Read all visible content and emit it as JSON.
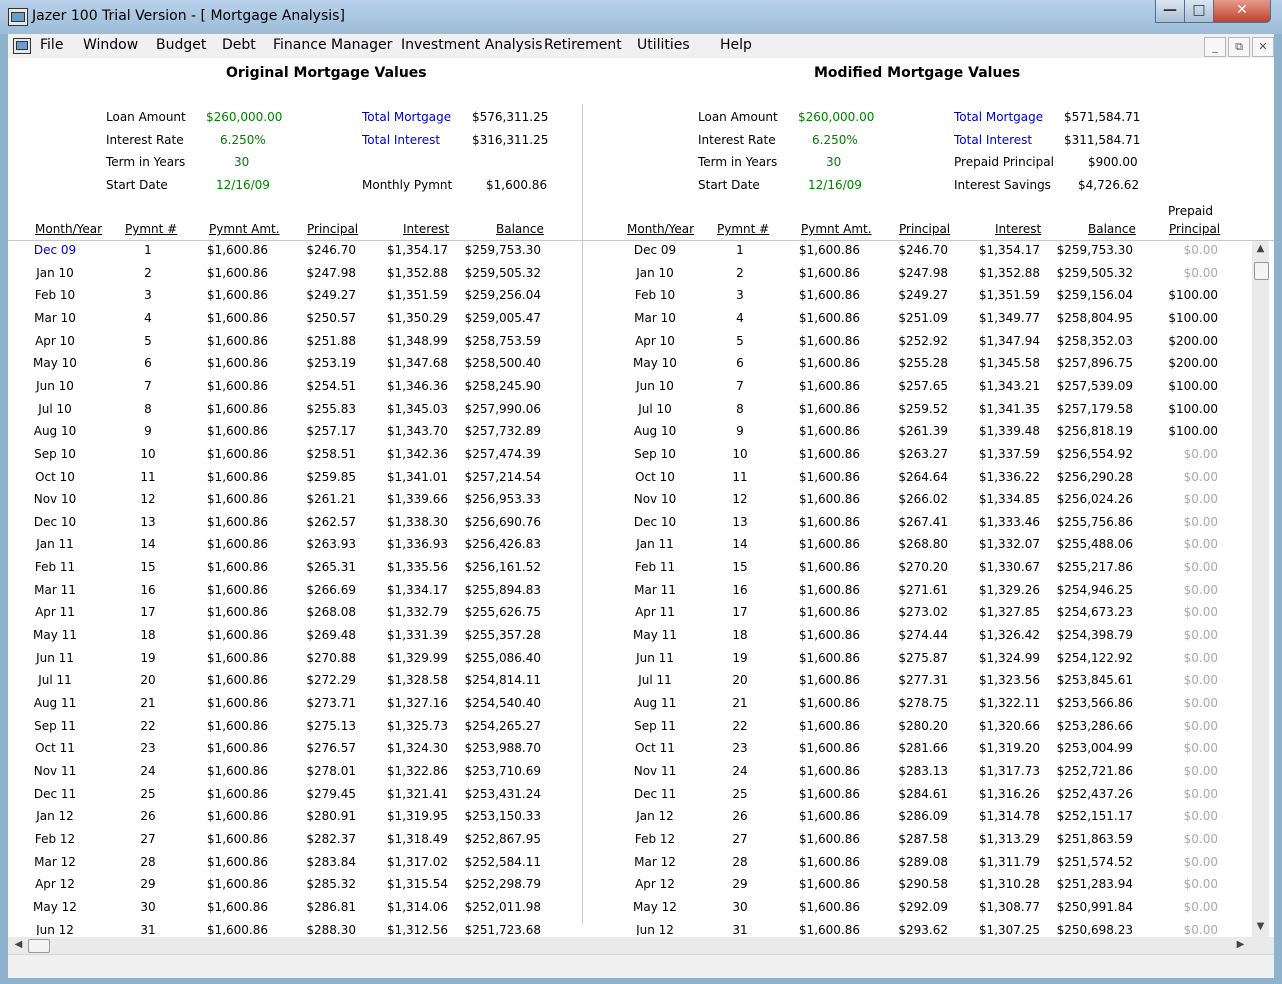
{
  "window": {
    "title": "Jazer 100 Trial Version - [ Mortgage Analysis]"
  },
  "menu": [
    "File",
    "Window",
    "Budget",
    "Debt",
    "Finance Manager",
    "Investment Analysis",
    "Retirement",
    "Utilities",
    "Help"
  ],
  "original": {
    "title": "Original Mortgage Values",
    "loan_amount_label": "Loan Amount",
    "loan_amount": "$260,000.00",
    "interest_rate_label": "Interest Rate",
    "interest_rate": "6.250%",
    "term_label": "Term in Years",
    "term": "30",
    "start_date_label": "Start Date",
    "start_date": "12/16/09",
    "total_mortgage_label": "Total Mortgage",
    "total_mortgage": "$576,311.25",
    "total_interest_label": "Total Interest",
    "total_interest": "$316,311.25",
    "monthly_pymnt_label": "Monthly Pymnt",
    "monthly_pymnt": "$1,600.86"
  },
  "modified": {
    "title": "Modified Mortgage Values",
    "loan_amount_label": "Loan Amount",
    "loan_amount": "$260,000.00",
    "interest_rate_label": "Interest Rate",
    "interest_rate": "6.250%",
    "term_label": "Term in Years",
    "term": "30",
    "start_date_label": "Start Date",
    "start_date": "12/16/09",
    "total_mortgage_label": "Total Mortgage",
    "total_mortgage": "$571,584.71",
    "total_interest_label": "Total Interest",
    "total_interest": "$311,584.71",
    "prepaid_principal_label": "Prepaid Principal",
    "prepaid_principal": "$900.00",
    "interest_savings_label": "Interest Savings",
    "interest_savings": "$4,726.62"
  },
  "columns": {
    "month_year": "Month/Year",
    "pymnt_num": "Pymnt #",
    "pymnt_amt": "Pymnt Amt.",
    "principal": "Principal",
    "interest": "Interest",
    "balance": "Balance",
    "prepaid_line1": "Prepaid",
    "prepaid_line2": "Principal"
  },
  "colors": {
    "green": "#008000",
    "blue": "#0000cc",
    "gray": "#aaaaaa"
  },
  "rows": [
    {
      "m": "Dec 09",
      "n": "1",
      "amt": "$1,600.86",
      "op": "$246.70",
      "oi": "$1,354.17",
      "ob": "$259,753.30",
      "mp": "$246.70",
      "mi": "$1,354.17",
      "mb": "$259,753.30",
      "pp": "$0.00"
    },
    {
      "m": "Jan 10",
      "n": "2",
      "amt": "$1,600.86",
      "op": "$247.98",
      "oi": "$1,352.88",
      "ob": "$259,505.32",
      "mp": "$247.98",
      "mi": "$1,352.88",
      "mb": "$259,505.32",
      "pp": "$0.00"
    },
    {
      "m": "Feb 10",
      "n": "3",
      "amt": "$1,600.86",
      "op": "$249.27",
      "oi": "$1,351.59",
      "ob": "$259,256.04",
      "mp": "$249.27",
      "mi": "$1,351.59",
      "mb": "$259,156.04",
      "pp": "$100.00"
    },
    {
      "m": "Mar 10",
      "n": "4",
      "amt": "$1,600.86",
      "op": "$250.57",
      "oi": "$1,350.29",
      "ob": "$259,005.47",
      "mp": "$251.09",
      "mi": "$1,349.77",
      "mb": "$258,804.95",
      "pp": "$100.00"
    },
    {
      "m": "Apr 10",
      "n": "5",
      "amt": "$1,600.86",
      "op": "$251.88",
      "oi": "$1,348.99",
      "ob": "$258,753.59",
      "mp": "$252.92",
      "mi": "$1,347.94",
      "mb": "$258,352.03",
      "pp": "$200.00"
    },
    {
      "m": "May 10",
      "n": "6",
      "amt": "$1,600.86",
      "op": "$253.19",
      "oi": "$1,347.68",
      "ob": "$258,500.40",
      "mp": "$255.28",
      "mi": "$1,345.58",
      "mb": "$257,896.75",
      "pp": "$200.00"
    },
    {
      "m": "Jun 10",
      "n": "7",
      "amt": "$1,600.86",
      "op": "$254.51",
      "oi": "$1,346.36",
      "ob": "$258,245.90",
      "mp": "$257.65",
      "mi": "$1,343.21",
      "mb": "$257,539.09",
      "pp": "$100.00"
    },
    {
      "m": "Jul 10",
      "n": "8",
      "amt": "$1,600.86",
      "op": "$255.83",
      "oi": "$1,345.03",
      "ob": "$257,990.06",
      "mp": "$259.52",
      "mi": "$1,341.35",
      "mb": "$257,179.58",
      "pp": "$100.00"
    },
    {
      "m": "Aug 10",
      "n": "9",
      "amt": "$1,600.86",
      "op": "$257.17",
      "oi": "$1,343.70",
      "ob": "$257,732.89",
      "mp": "$261.39",
      "mi": "$1,339.48",
      "mb": "$256,818.19",
      "pp": "$100.00"
    },
    {
      "m": "Sep 10",
      "n": "10",
      "amt": "$1,600.86",
      "op": "$258.51",
      "oi": "$1,342.36",
      "ob": "$257,474.39",
      "mp": "$263.27",
      "mi": "$1,337.59",
      "mb": "$256,554.92",
      "pp": "$0.00"
    },
    {
      "m": "Oct 10",
      "n": "11",
      "amt": "$1,600.86",
      "op": "$259.85",
      "oi": "$1,341.01",
      "ob": "$257,214.54",
      "mp": "$264.64",
      "mi": "$1,336.22",
      "mb": "$256,290.28",
      "pp": "$0.00"
    },
    {
      "m": "Nov 10",
      "n": "12",
      "amt": "$1,600.86",
      "op": "$261.21",
      "oi": "$1,339.66",
      "ob": "$256,953.33",
      "mp": "$266.02",
      "mi": "$1,334.85",
      "mb": "$256,024.26",
      "pp": "$0.00"
    },
    {
      "m": "Dec 10",
      "n": "13",
      "amt": "$1,600.86",
      "op": "$262.57",
      "oi": "$1,338.30",
      "ob": "$256,690.76",
      "mp": "$267.41",
      "mi": "$1,333.46",
      "mb": "$255,756.86",
      "pp": "$0.00"
    },
    {
      "m": "Jan 11",
      "n": "14",
      "amt": "$1,600.86",
      "op": "$263.93",
      "oi": "$1,336.93",
      "ob": "$256,426.83",
      "mp": "$268.80",
      "mi": "$1,332.07",
      "mb": "$255,488.06",
      "pp": "$0.00"
    },
    {
      "m": "Feb 11",
      "n": "15",
      "amt": "$1,600.86",
      "op": "$265.31",
      "oi": "$1,335.56",
      "ob": "$256,161.52",
      "mp": "$270.20",
      "mi": "$1,330.67",
      "mb": "$255,217.86",
      "pp": "$0.00"
    },
    {
      "m": "Mar 11",
      "n": "16",
      "amt": "$1,600.86",
      "op": "$266.69",
      "oi": "$1,334.17",
      "ob": "$255,894.83",
      "mp": "$271.61",
      "mi": "$1,329.26",
      "mb": "$254,946.25",
      "pp": "$0.00"
    },
    {
      "m": "Apr 11",
      "n": "17",
      "amt": "$1,600.86",
      "op": "$268.08",
      "oi": "$1,332.79",
      "ob": "$255,626.75",
      "mp": "$273.02",
      "mi": "$1,327.85",
      "mb": "$254,673.23",
      "pp": "$0.00"
    },
    {
      "m": "May 11",
      "n": "18",
      "amt": "$1,600.86",
      "op": "$269.48",
      "oi": "$1,331.39",
      "ob": "$255,357.28",
      "mp": "$274.44",
      "mi": "$1,326.42",
      "mb": "$254,398.79",
      "pp": "$0.00"
    },
    {
      "m": "Jun 11",
      "n": "19",
      "amt": "$1,600.86",
      "op": "$270.88",
      "oi": "$1,329.99",
      "ob": "$255,086.40",
      "mp": "$275.87",
      "mi": "$1,324.99",
      "mb": "$254,122.92",
      "pp": "$0.00"
    },
    {
      "m": "Jul 11",
      "n": "20",
      "amt": "$1,600.86",
      "op": "$272.29",
      "oi": "$1,328.58",
      "ob": "$254,814.11",
      "mp": "$277.31",
      "mi": "$1,323.56",
      "mb": "$253,845.61",
      "pp": "$0.00"
    },
    {
      "m": "Aug 11",
      "n": "21",
      "amt": "$1,600.86",
      "op": "$273.71",
      "oi": "$1,327.16",
      "ob": "$254,540.40",
      "mp": "$278.75",
      "mi": "$1,322.11",
      "mb": "$253,566.86",
      "pp": "$0.00"
    },
    {
      "m": "Sep 11",
      "n": "22",
      "amt": "$1,600.86",
      "op": "$275.13",
      "oi": "$1,325.73",
      "ob": "$254,265.27",
      "mp": "$280.20",
      "mi": "$1,320.66",
      "mb": "$253,286.66",
      "pp": "$0.00"
    },
    {
      "m": "Oct 11",
      "n": "23",
      "amt": "$1,600.86",
      "op": "$276.57",
      "oi": "$1,324.30",
      "ob": "$253,988.70",
      "mp": "$281.66",
      "mi": "$1,319.20",
      "mb": "$253,004.99",
      "pp": "$0.00"
    },
    {
      "m": "Nov 11",
      "n": "24",
      "amt": "$1,600.86",
      "op": "$278.01",
      "oi": "$1,322.86",
      "ob": "$253,710.69",
      "mp": "$283.13",
      "mi": "$1,317.73",
      "mb": "$252,721.86",
      "pp": "$0.00"
    },
    {
      "m": "Dec 11",
      "n": "25",
      "amt": "$1,600.86",
      "op": "$279.45",
      "oi": "$1,321.41",
      "ob": "$253,431.24",
      "mp": "$284.61",
      "mi": "$1,316.26",
      "mb": "$252,437.26",
      "pp": "$0.00"
    },
    {
      "m": "Jan 12",
      "n": "26",
      "amt": "$1,600.86",
      "op": "$280.91",
      "oi": "$1,319.95",
      "ob": "$253,150.33",
      "mp": "$286.09",
      "mi": "$1,314.78",
      "mb": "$252,151.17",
      "pp": "$0.00"
    },
    {
      "m": "Feb 12",
      "n": "27",
      "amt": "$1,600.86",
      "op": "$282.37",
      "oi": "$1,318.49",
      "ob": "$252,867.95",
      "mp": "$287.58",
      "mi": "$1,313.29",
      "mb": "$251,863.59",
      "pp": "$0.00"
    },
    {
      "m": "Mar 12",
      "n": "28",
      "amt": "$1,600.86",
      "op": "$283.84",
      "oi": "$1,317.02",
      "ob": "$252,584.11",
      "mp": "$289.08",
      "mi": "$1,311.79",
      "mb": "$251,574.52",
      "pp": "$0.00"
    },
    {
      "m": "Apr 12",
      "n": "29",
      "amt": "$1,600.86",
      "op": "$285.32",
      "oi": "$1,315.54",
      "ob": "$252,298.79",
      "mp": "$290.58",
      "mi": "$1,310.28",
      "mb": "$251,283.94",
      "pp": "$0.00"
    },
    {
      "m": "May 12",
      "n": "30",
      "amt": "$1,600.86",
      "op": "$286.81",
      "oi": "$1,314.06",
      "ob": "$252,011.98",
      "mp": "$292.09",
      "mi": "$1,308.77",
      "mb": "$250,991.84",
      "pp": "$0.00"
    },
    {
      "m": "Jun 12",
      "n": "31",
      "amt": "$1,600.86",
      "op": "$288.30",
      "oi": "$1,312.56",
      "ob": "$251,723.68",
      "mp": "$293.62",
      "mi": "$1,307.25",
      "mb": "$250,698.23",
      "pp": "$0.00"
    }
  ]
}
